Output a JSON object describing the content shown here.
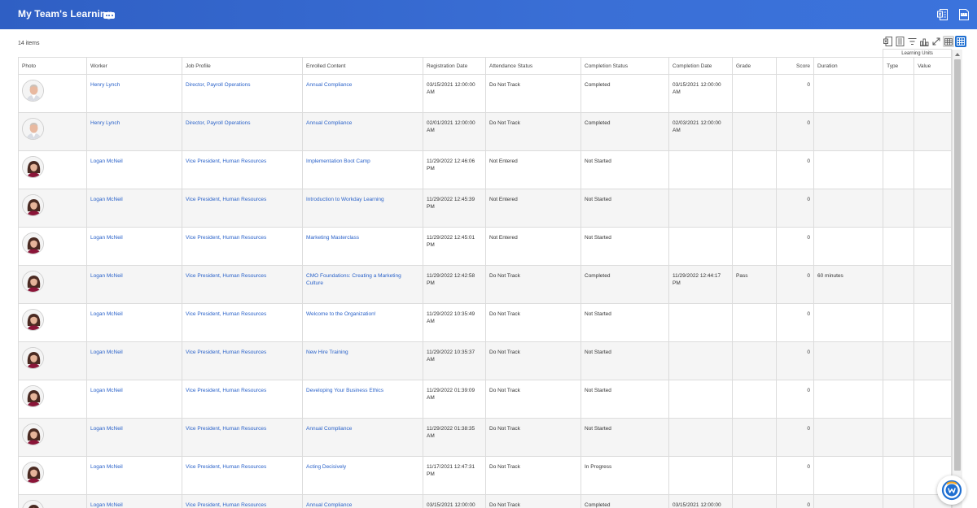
{
  "header": {
    "title": "My Team's Learning"
  },
  "grid": {
    "count_label": "14 items",
    "group_header": "Learning Units",
    "columns": [
      "Photo",
      "Worker",
      "Job Profile",
      "Enrolled Content",
      "Registration Date",
      "Attendance Status",
      "Completion Status",
      "Completion Date",
      "Grade",
      "Score",
      "Duration",
      "Type",
      "Value"
    ],
    "rows": [
      {
        "avatar": "man",
        "worker": "Henry Lynch",
        "job_profile": "Director, Payroll Operations",
        "content": "Annual Compliance",
        "reg_date": "03/15/2021 12:00:00 AM",
        "attendance": "Do Not Track",
        "completion": "Completed",
        "completion_date": "03/15/2021 12:00:00 AM",
        "grade": "",
        "score": "0",
        "duration": "",
        "type": "",
        "value": ""
      },
      {
        "avatar": "man",
        "worker": "Henry Lynch",
        "job_profile": "Director, Payroll Operations",
        "content": "Annual Compliance",
        "reg_date": "02/01/2021 12:00:00 AM",
        "attendance": "Do Not Track",
        "completion": "Completed",
        "completion_date": "02/03/2021 12:00:00 AM",
        "grade": "",
        "score": "0",
        "duration": "",
        "type": "",
        "value": ""
      },
      {
        "avatar": "woman",
        "worker": "Logan McNeil",
        "job_profile": "Vice President, Human Resources",
        "content": "Implementation Boot Camp",
        "reg_date": "11/29/2022 12:46:06 PM",
        "attendance": "Not Entered",
        "completion": "Not Started",
        "completion_date": "",
        "grade": "",
        "score": "0",
        "duration": "",
        "type": "",
        "value": ""
      },
      {
        "avatar": "woman",
        "worker": "Logan McNeil",
        "job_profile": "Vice President, Human Resources",
        "content": "Introduction to Workday Learning",
        "reg_date": "11/29/2022 12:45:39 PM",
        "attendance": "Not Entered",
        "completion": "Not Started",
        "completion_date": "",
        "grade": "",
        "score": "0",
        "duration": "",
        "type": "",
        "value": ""
      },
      {
        "avatar": "woman",
        "worker": "Logan McNeil",
        "job_profile": "Vice President, Human Resources",
        "content": "Marketing Masterclass",
        "reg_date": "11/29/2022 12:45:01 PM",
        "attendance": "Not Entered",
        "completion": "Not Started",
        "completion_date": "",
        "grade": "",
        "score": "0",
        "duration": "",
        "type": "",
        "value": ""
      },
      {
        "avatar": "woman",
        "worker": "Logan McNeil",
        "job_profile": "Vice President, Human Resources",
        "content": "CMO Foundations: Creating a Marketing Culture",
        "reg_date": "11/29/2022 12:42:58 PM",
        "attendance": "Do Not Track",
        "completion": "Completed",
        "completion_date": "11/29/2022 12:44:17 PM",
        "grade": "Pass",
        "score": "0",
        "duration": "60 minutes",
        "type": "",
        "value": ""
      },
      {
        "avatar": "woman",
        "worker": "Logan McNeil",
        "job_profile": "Vice President, Human Resources",
        "content": "Welcome to the Organization!",
        "reg_date": "11/29/2022 10:35:49 AM",
        "attendance": "Do Not Track",
        "completion": "Not Started",
        "completion_date": "",
        "grade": "",
        "score": "0",
        "duration": "",
        "type": "",
        "value": ""
      },
      {
        "avatar": "woman",
        "worker": "Logan McNeil",
        "job_profile": "Vice President, Human Resources",
        "content": "New Hire Training",
        "reg_date": "11/29/2022 10:35:37 AM",
        "attendance": "Do Not Track",
        "completion": "Not Started",
        "completion_date": "",
        "grade": "",
        "score": "0",
        "duration": "",
        "type": "",
        "value": ""
      },
      {
        "avatar": "woman",
        "worker": "Logan McNeil",
        "job_profile": "Vice President, Human Resources",
        "content": "Developing Your Business Ethics",
        "reg_date": "11/29/2022 01:39:09 AM",
        "attendance": "Do Not Track",
        "completion": "Not Started",
        "completion_date": "",
        "grade": "",
        "score": "0",
        "duration": "",
        "type": "",
        "value": ""
      },
      {
        "avatar": "woman",
        "worker": "Logan McNeil",
        "job_profile": "Vice President, Human Resources",
        "content": "Annual Compliance",
        "reg_date": "11/29/2022 01:38:35 AM",
        "attendance": "Do Not Track",
        "completion": "Not Started",
        "completion_date": "",
        "grade": "",
        "score": "0",
        "duration": "",
        "type": "",
        "value": ""
      },
      {
        "avatar": "woman",
        "worker": "Logan McNeil",
        "job_profile": "Vice President, Human Resources",
        "content": "Acting Decisively",
        "reg_date": "11/17/2021 12:47:31 PM",
        "attendance": "Do Not Track",
        "completion": "In Progress",
        "completion_date": "",
        "grade": "",
        "score": "0",
        "duration": "",
        "type": "",
        "value": ""
      },
      {
        "avatar": "woman",
        "worker": "Logan McNeil",
        "job_profile": "Vice President, Human Resources",
        "content": "Annual Compliance",
        "reg_date": "03/15/2021 12:00:00",
        "attendance": "Do Not Track",
        "completion": "Completed",
        "completion_date": "03/15/2021 12:00:00",
        "grade": "",
        "score": "0",
        "duration": "",
        "type": "",
        "value": ""
      }
    ]
  },
  "icons": {
    "header_actions": [
      "excel-export-icon",
      "pdf-export-icon"
    ],
    "toolbar": [
      "excel-export-icon",
      "print-icon",
      "filter-icon",
      "chart-icon",
      "fullscreen-icon",
      "table-view-icon",
      "grid-view-icon"
    ],
    "help": "workday-help-icon"
  },
  "colors": {
    "header": "#3b6fd6",
    "link": "#2a62c9",
    "toolbar_selected": "#1f6fd1"
  }
}
